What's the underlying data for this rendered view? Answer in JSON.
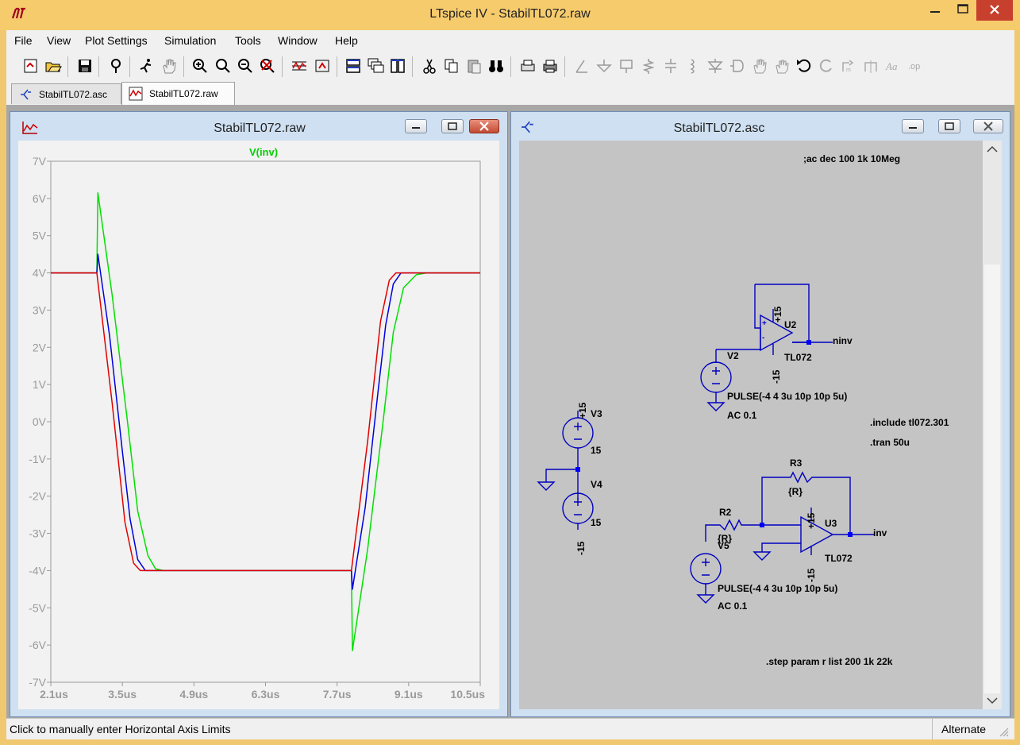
{
  "window": {
    "title": "LTspice IV - StabilTL072.raw"
  },
  "menu": [
    "File",
    "View",
    "Plot Settings",
    "Simulation",
    "Tools",
    "Window",
    "Help"
  ],
  "tabs": [
    {
      "label": "StabilTL072.asc",
      "icon": "schematic-icon"
    },
    {
      "label": "StabilTL072.raw",
      "icon": "waveform-icon"
    }
  ],
  "waveform_window": {
    "title": "StabilTL072.raw",
    "trace_label": "V(inv)",
    "trace_label_color": "#00d000"
  },
  "schematic_window": {
    "title": "StabilTL072.asc",
    "directives": {
      "ac": ";ac dec 100 1k 10Meg",
      "include": ".include tl072.301",
      "tran": ".tran 50u",
      "step": ".step param r list 200 1k 22k"
    },
    "components": {
      "u2": {
        "ref": "U2",
        "model": "TL072",
        "vpos": "+15",
        "vneg": "-15"
      },
      "u3": {
        "ref": "U3",
        "model": "TL072",
        "vpos": "+15",
        "vneg": "-15"
      },
      "v2": {
        "ref": "V2",
        "value": "PULSE(-4 4 3u 10p 10p 5u)",
        "ac": "AC 0.1"
      },
      "v3": {
        "ref": "V3",
        "value": "15",
        "net": "+15"
      },
      "v4": {
        "ref": "V4",
        "value": "15",
        "net": "-15"
      },
      "v5": {
        "ref": "V5",
        "value": "PULSE(-4 4 3u 10p 10p 5u)",
        "ac": "AC 0.1"
      },
      "r2": {
        "ref": "R2",
        "value": "{R}"
      },
      "r3": {
        "ref": "R3",
        "value": "{R}"
      }
    },
    "net_labels": {
      "ninv": "ninv",
      "inv": "inv"
    }
  },
  "statusbar": {
    "message": "Click to manually enter Horizontal Axis Limits",
    "mode": "Alternate"
  },
  "chart_data": {
    "type": "line",
    "title": "",
    "xlabel": "",
    "ylabel": "",
    "xlim": [
      2.1,
      10.5
    ],
    "ylim": [
      -7,
      7
    ],
    "x_unit": "us",
    "y_unit": "V",
    "x_ticks": [
      "2.1us",
      "3.5us",
      "4.9us",
      "6.3us",
      "7.7us",
      "9.1us",
      "10.5us"
    ],
    "y_ticks": [
      "7V",
      "6V",
      "5V",
      "4V",
      "3V",
      "2V",
      "1V",
      "0V",
      "-1V",
      "-2V",
      "-3V",
      "-4V",
      "-5V",
      "-6V",
      "-7V"
    ],
    "grid": false,
    "series": [
      {
        "color": "#00e000",
        "x": [
          2.1,
          3.0,
          3.02,
          3.3,
          3.6,
          3.8,
          4.0,
          4.15,
          4.3,
          7.98,
          8.0,
          8.3,
          8.6,
          8.8,
          9.0,
          9.25,
          9.45,
          10.5
        ],
        "y": [
          4.0,
          4.0,
          6.15,
          3.4,
          0.0,
          -2.4,
          -3.6,
          -3.95,
          -4.0,
          -4.0,
          -6.15,
          -3.4,
          0.0,
          2.4,
          3.6,
          3.95,
          4.0,
          4.0
        ]
      },
      {
        "color": "#0000e0",
        "x": [
          2.1,
          3.0,
          3.02,
          3.25,
          3.5,
          3.65,
          3.8,
          3.95,
          7.98,
          8.0,
          8.25,
          8.5,
          8.65,
          8.8,
          8.95,
          10.5
        ],
        "y": [
          4.0,
          4.0,
          4.5,
          2.3,
          -0.8,
          -2.6,
          -3.7,
          -4.0,
          -4.0,
          -4.5,
          -2.3,
          0.8,
          2.6,
          3.7,
          4.0,
          4.0
        ]
      },
      {
        "color": "#e00000",
        "x": [
          2.1,
          3.0,
          3.3,
          3.55,
          3.72,
          3.85,
          7.98,
          8.3,
          8.55,
          8.72,
          8.85,
          10.5
        ],
        "y": [
          4.0,
          4.0,
          0.5,
          -2.7,
          -3.8,
          -4.0,
          -4.0,
          -0.5,
          2.7,
          3.8,
          4.0,
          4.0
        ]
      }
    ]
  }
}
